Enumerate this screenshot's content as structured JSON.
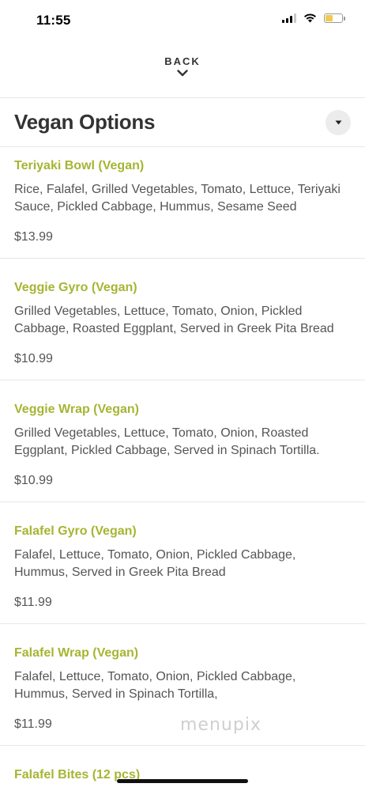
{
  "status_bar": {
    "time": "11:55",
    "icons": [
      "cellular-signal-icon",
      "wifi-icon",
      "battery-icon"
    ],
    "battery_color": "#f2c94c"
  },
  "nav": {
    "back_label": "BACK",
    "back_icon": "chevron-down-icon"
  },
  "section": {
    "title": "Vegan Options",
    "toggle_icon": "caret-down-icon"
  },
  "colors": {
    "item_name": "#a6b533",
    "text": "#555555",
    "divider": "#e7e7e7"
  },
  "items": [
    {
      "name": "Teriyaki Bowl (Vegan)",
      "description": "Rice, Falafel, Grilled Vegetables, Tomato, Lettuce, Teriyaki Sauce, Pickled Cabbage, Hummus, Sesame Seed",
      "price": "$13.99"
    },
    {
      "name": "Veggie Gyro (Vegan)",
      "description": "Grilled Vegetables, Lettuce, Tomato, Onion, Pickled Cabbage, Roasted Eggplant, Served in Greek Pita Bread",
      "price": "$10.99"
    },
    {
      "name": "Veggie Wrap (Vegan)",
      "description": "Grilled Vegetables, Lettuce, Tomato, Onion, Roasted Eggplant, Pickled Cabbage, Served in Spinach Tortilla.",
      "price": "$10.99"
    },
    {
      "name": "Falafel Gyro (Vegan)",
      "description": "Falafel, Lettuce, Tomato, Onion, Pickled Cabbage, Hummus, Served in Greek Pita Bread",
      "price": "$11.99"
    },
    {
      "name": "Falafel Wrap (Vegan)",
      "description": "Falafel, Lettuce, Tomato, Onion, Pickled Cabbage, Hummus, Served in Spinach Tortilla,",
      "price": "$11.99"
    },
    {
      "name": "Falafel Bites (12 pcs)",
      "description": "",
      "price": ""
    }
  ],
  "watermark": "menupix"
}
